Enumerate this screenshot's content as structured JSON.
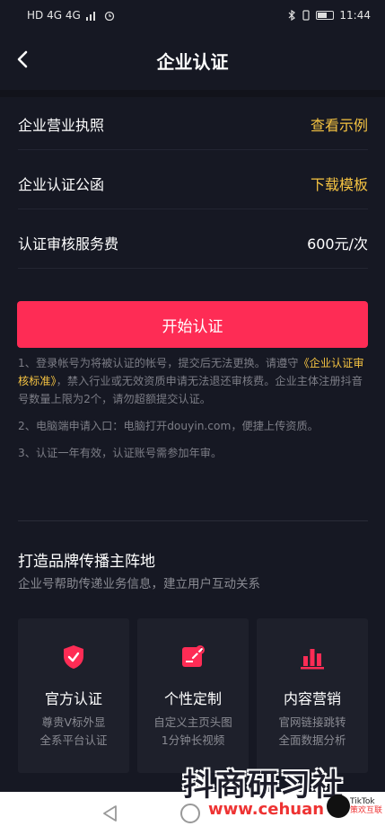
{
  "status_bar": {
    "left": "HD 4G 4G",
    "time": "11:44"
  },
  "header": {
    "title": "企业认证"
  },
  "rows": [
    {
      "label": "企业营业执照",
      "value": "查看示例"
    },
    {
      "label": "企业认证公函",
      "value": "下载模板"
    },
    {
      "label": "认证审核服务费",
      "value": "600元/次"
    }
  ],
  "primary_button": "开始认证",
  "notes": {
    "n1_pre": "1、登录帐号为将被认证的帐号，提交后无法更换。请遵守",
    "n1_link": "《企业认证审核标准》",
    "n1_post": "，禁入行业或无效资质申请无法退还审核费。企业主体注册抖音号数量上限为2个，请勿超额提交认证。",
    "n2": "2、电脑端申请入口：电脑打开douyin.com，便捷上传资质。",
    "n3": "3、认证一年有效，认证账号需参加年审。"
  },
  "section": {
    "title": "打造品牌传播主阵地",
    "subtitle": "企业号帮助传递业务信息，建立用户互动关系"
  },
  "cards": [
    {
      "title": "官方认证",
      "line1": "尊贵V标外显",
      "line2": "全系平台认证",
      "icon": "shield-check-icon"
    },
    {
      "title": "个性定制",
      "line1": "自定义主页头图",
      "line2": "1分钟长视频",
      "icon": "edit-card-icon"
    },
    {
      "title": "内容营销",
      "line1": "官网链接跳转",
      "line2": "全面数据分析",
      "icon": "bar-chart-icon"
    }
  ],
  "watermark": {
    "text": "抖商研习社",
    "url": "www.cehuan",
    "tiktok": "TikTok",
    "tiktok_sub": "策欢互联"
  },
  "colors": {
    "background": "#161823",
    "accent": "#fe2c55",
    "link": "#f5c342",
    "card": "#1e202b"
  }
}
